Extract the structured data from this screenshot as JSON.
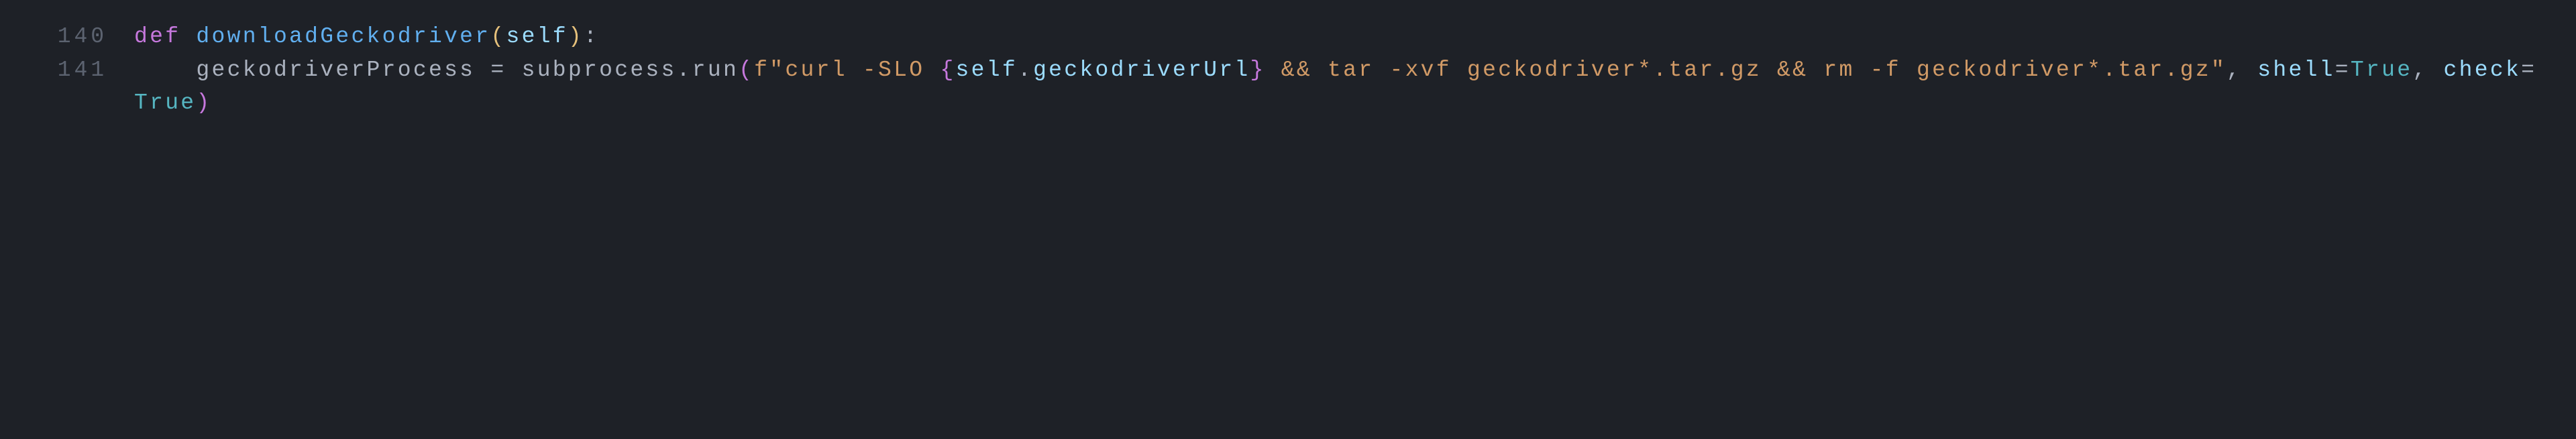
{
  "lines": {
    "l140": "140",
    "l141": "141"
  },
  "code": {
    "kw_def": "def",
    "sp": " ",
    "func_name": "downloadGeckodriver",
    "lparen": "(",
    "self": "self",
    "rparen": ")",
    "colon": ":",
    "indent": "    ",
    "var_geckodriver": "geckodriverProcess",
    "eq": " = ",
    "subprocess": "subprocess",
    "dot": ".",
    "run": "run",
    "lparen2": "(",
    "f_prefix": "f",
    "str_open": "\"",
    "str_part1": "curl -SLO ",
    "fbrace_open": "{",
    "fexpr_self": "self",
    "fexpr_dot": ".",
    "fexpr_attr": "geckodriverUrl",
    "fbrace_close": "}",
    "str_part2": " && tar -xvf geckodriver*.tar.gz && rm -f geckodriver*.tar.gz",
    "str_close": "\"",
    "comma1": ", ",
    "kwarg_shell": "shell",
    "eq2": "=",
    "true1": "True",
    "comma2": ", ",
    "kwarg_check": "check",
    "eq3": "=",
    "true2": "True",
    "rparen2": ")"
  }
}
